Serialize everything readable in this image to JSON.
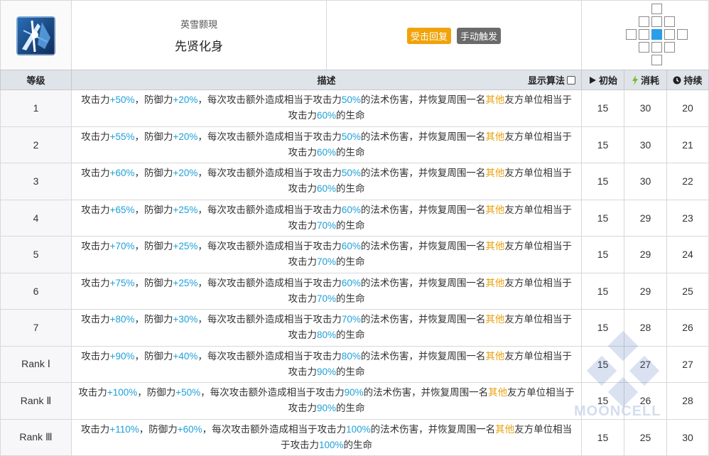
{
  "skill": {
    "sub_title": "英雪颢現",
    "name": "先贤化身",
    "tags": [
      "受击回复",
      "手动触发"
    ],
    "colors": {
      "recovery": "#f0a30a",
      "trigger": "#6b6b6b",
      "highlight": "#1ea0d8",
      "keyword": "#e8a10c"
    }
  },
  "headers": {
    "level": "等级",
    "desc": "描述",
    "algo": "显示算法",
    "initial": "初始",
    "cost": "消耗",
    "duration": "持续"
  },
  "text": {
    "atk": "攻击力",
    "comma1": "，",
    "def": "防御力",
    "mid": "，每次攻击额外造成相当于攻击力",
    "mid2": "的法术伤害，并恢复周围一名",
    "other": "其他",
    "tail": "友方单位相当于攻击力",
    "end": "的生命"
  },
  "rows": [
    {
      "level": "1",
      "atk": "+50%",
      "def": "+20%",
      "dmg": "50%",
      "heal": "60%",
      "initial": "15",
      "cost": "30",
      "duration": "20"
    },
    {
      "level": "2",
      "atk": "+55%",
      "def": "+20%",
      "dmg": "50%",
      "heal": "60%",
      "initial": "15",
      "cost": "30",
      "duration": "21"
    },
    {
      "level": "3",
      "atk": "+60%",
      "def": "+20%",
      "dmg": "50%",
      "heal": "60%",
      "initial": "15",
      "cost": "30",
      "duration": "22"
    },
    {
      "level": "4",
      "atk": "+65%",
      "def": "+25%",
      "dmg": "60%",
      "heal": "70%",
      "initial": "15",
      "cost": "29",
      "duration": "23"
    },
    {
      "level": "5",
      "atk": "+70%",
      "def": "+25%",
      "dmg": "60%",
      "heal": "70%",
      "initial": "15",
      "cost": "29",
      "duration": "24"
    },
    {
      "level": "6",
      "atk": "+75%",
      "def": "+25%",
      "dmg": "60%",
      "heal": "70%",
      "initial": "15",
      "cost": "29",
      "duration": "25"
    },
    {
      "level": "7",
      "atk": "+80%",
      "def": "+30%",
      "dmg": "70%",
      "heal": "80%",
      "initial": "15",
      "cost": "28",
      "duration": "26"
    },
    {
      "level": "Rank Ⅰ",
      "atk": "+90%",
      "def": "+40%",
      "dmg": "80%",
      "heal": "90%",
      "initial": "15",
      "cost": "27",
      "duration": "27"
    },
    {
      "level": "Rank Ⅱ",
      "atk": "+100%",
      "def": "+50%",
      "dmg": "90%",
      "heal": "90%",
      "initial": "15",
      "cost": "26",
      "duration": "28"
    },
    {
      "level": "Rank Ⅲ",
      "atk": "+110%",
      "def": "+60%",
      "dmg": "100%",
      "heal": "100%",
      "initial": "15",
      "cost": "25",
      "duration": "30"
    }
  ],
  "range_grid": [
    [
      0,
      0,
      0,
      1,
      0,
      0,
      0
    ],
    [
      0,
      0,
      1,
      1,
      1,
      0,
      0
    ],
    [
      0,
      1,
      1,
      2,
      1,
      1,
      0
    ],
    [
      0,
      0,
      1,
      1,
      1,
      0,
      0
    ],
    [
      0,
      0,
      0,
      1,
      0,
      0,
      0
    ]
  ],
  "watermark": "MOONCELL"
}
